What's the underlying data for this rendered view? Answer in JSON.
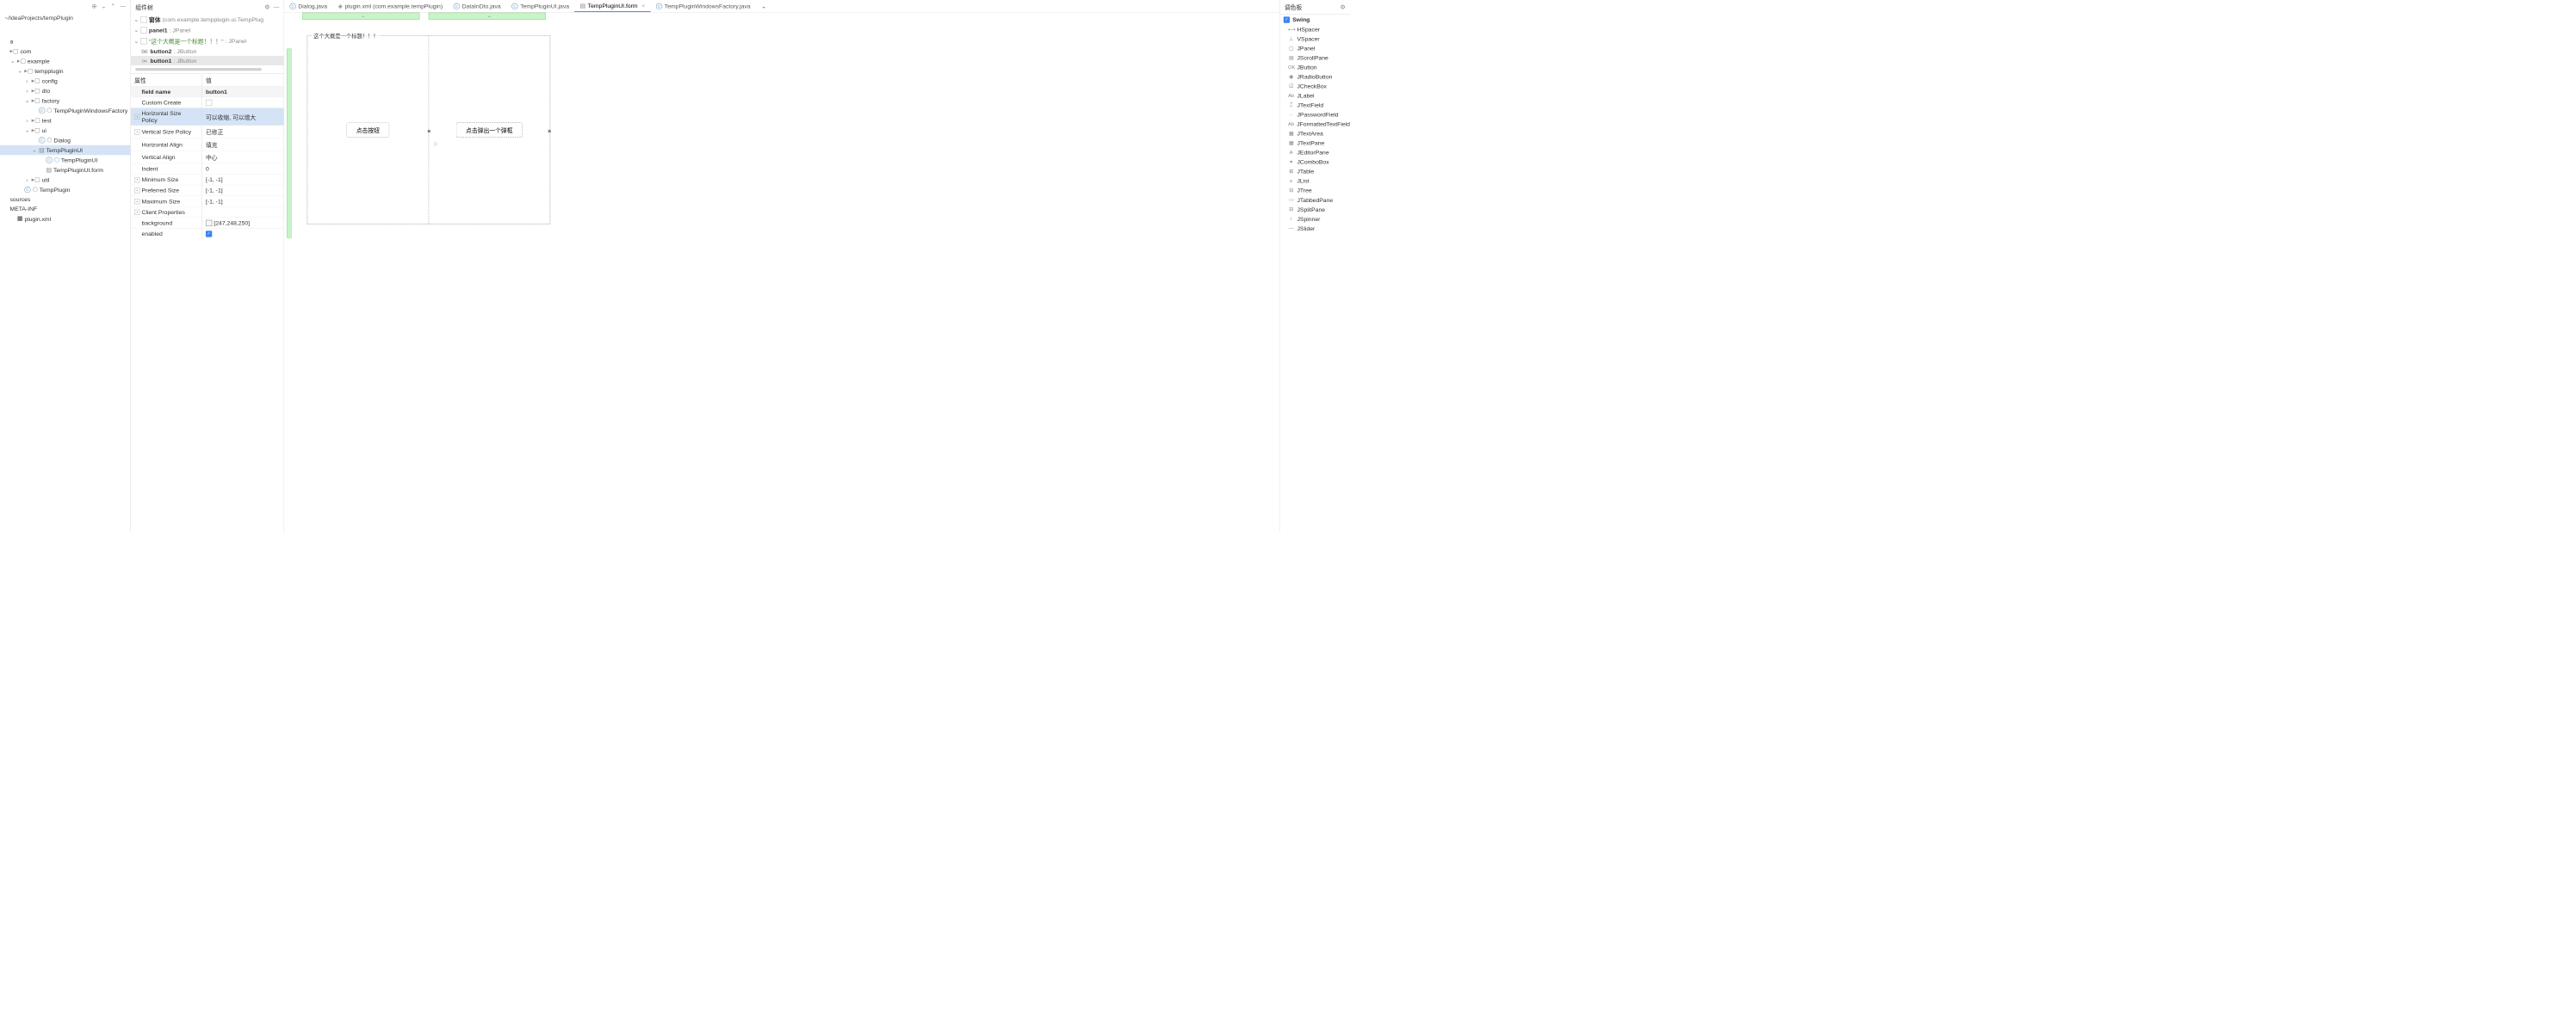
{
  "project": {
    "path": "~/IdeaProjects/tempPlugin",
    "tree": [
      {
        "indent": 0,
        "icon": "text",
        "label": "a"
      },
      {
        "indent": 0,
        "icon": "folder",
        "label": "com"
      },
      {
        "indent": 1,
        "icon": "folder",
        "label": "example",
        "chevron": "v"
      },
      {
        "indent": 2,
        "icon": "folder",
        "label": "tempplugin",
        "chevron": "v"
      },
      {
        "indent": 3,
        "icon": "folder",
        "label": "config",
        "chevron": ">"
      },
      {
        "indent": 3,
        "icon": "folder",
        "label": "dto",
        "chevron": ">"
      },
      {
        "indent": 3,
        "icon": "folder",
        "label": "factory",
        "chevron": "v"
      },
      {
        "indent": 4,
        "icon": "java",
        "label": "TempPluginWindowsFactory"
      },
      {
        "indent": 3,
        "icon": "folder",
        "label": "test",
        "chevron": ">"
      },
      {
        "indent": 3,
        "icon": "folder",
        "label": "ui",
        "chevron": "v"
      },
      {
        "indent": 4,
        "icon": "java",
        "label": "Dialog"
      },
      {
        "indent": 4,
        "icon": "form",
        "label": "TempPluginUI",
        "chevron": "v",
        "selected": true
      },
      {
        "indent": 5,
        "icon": "java",
        "label": "TempPluginUI"
      },
      {
        "indent": 5,
        "icon": "form",
        "label": "TempPluginUI.form"
      },
      {
        "indent": 3,
        "icon": "folder",
        "label": "util",
        "chevron": ">"
      },
      {
        "indent": 2,
        "icon": "java",
        "label": "TempPlugin"
      },
      {
        "indent": 0,
        "icon": "text",
        "label": "sources"
      },
      {
        "indent": 0,
        "icon": "text",
        "label": "META-INF"
      },
      {
        "indent": 1,
        "icon": "xml",
        "label": "plugin.xml"
      }
    ]
  },
  "componentTree": {
    "title": "组件树",
    "items": [
      {
        "indent": 0,
        "chevron": "v",
        "name": "窗体",
        "type": "(com.example.tempplugin.ui.TempPlug"
      },
      {
        "indent": 1,
        "chevron": "v",
        "name": "panel1",
        "type": ": JPanel"
      },
      {
        "indent": 2,
        "chevron": "v",
        "title": "\"这个大概是一个标题！！！\"",
        "type": ": JPanel"
      },
      {
        "indent": 3,
        "ok": true,
        "name": "button2",
        "type": ": JButton"
      },
      {
        "indent": 3,
        "ok": true,
        "name": "button1",
        "type": ": JButton",
        "selected": true
      }
    ]
  },
  "properties": {
    "headers": {
      "name": "属性",
      "value": "值"
    },
    "rows": [
      {
        "name": "field name",
        "value": "button1",
        "header": true
      },
      {
        "name": "Custom Create",
        "value_type": "checkbox_empty"
      },
      {
        "name": "Horizontal Size Policy",
        "value": "可以收缩, 可以增大",
        "expandable": true,
        "selected": true
      },
      {
        "name": "Vertical Size Policy",
        "value": "已修正",
        "expandable": true
      },
      {
        "name": "Horizontal Align",
        "value": "填充"
      },
      {
        "name": "Vertical Align",
        "value": "中心"
      },
      {
        "name": "Indent",
        "value": "0"
      },
      {
        "name": "Minimum Size",
        "value": "[-1, -1]",
        "expandable": true
      },
      {
        "name": "Preferred Size",
        "value": "[-1, -1]",
        "expandable": true
      },
      {
        "name": "Maximum Size",
        "value": "[-1, -1]",
        "expandable": true
      },
      {
        "name": "Client Properties",
        "value": "",
        "expandable": true
      },
      {
        "name": "background",
        "value": "[247,248,250]",
        "color": true
      },
      {
        "name": "enabled",
        "value_type": "checkbox_checked"
      }
    ]
  },
  "tabs": [
    {
      "icon": "java",
      "label": "Dialog.java"
    },
    {
      "icon": "xml",
      "label": "plugin.xml (com.example.tempPlugin)"
    },
    {
      "icon": "java",
      "label": "DataInDto.java"
    },
    {
      "icon": "java",
      "label": "TempPluginUI.java"
    },
    {
      "icon": "form",
      "label": "TempPluginUI.form",
      "active": true,
      "close": true
    },
    {
      "icon": "java",
      "label": "TempPluginWindowsFactory.java"
    }
  ],
  "designer": {
    "formTitle": "这个大概是一个标题！！！",
    "button1": "点击按钮",
    "button2": "点击弹出一个弹框"
  },
  "palette": {
    "title": "调色板",
    "group": "Swing",
    "items": [
      {
        "icon": "⟷",
        "label": "HSpacer"
      },
      {
        "icon": "⊥",
        "label": "VSpacer"
      },
      {
        "icon": "▢",
        "label": "JPanel"
      },
      {
        "icon": "▤",
        "label": "JScrollPane"
      },
      {
        "icon": "OK",
        "label": "JButton"
      },
      {
        "icon": "◉",
        "label": "JRadioButton"
      },
      {
        "icon": "☑",
        "label": "JCheckBox"
      },
      {
        "icon": "Ab",
        "label": "JLabel"
      },
      {
        "icon": "⌶",
        "label": "JTextField"
      },
      {
        "icon": "··",
        "label": "JPasswordField"
      },
      {
        "icon": "Ab",
        "label": "JFormattedTextField"
      },
      {
        "icon": "▦",
        "label": "JTextArea"
      },
      {
        "icon": "▦",
        "label": "JTextPane"
      },
      {
        "icon": "A",
        "label": "JEditorPane"
      },
      {
        "icon": "▾",
        "label": "JComboBox"
      },
      {
        "icon": "⊞",
        "label": "JTable"
      },
      {
        "icon": "≡",
        "label": "JList"
      },
      {
        "icon": "⊟",
        "label": "JTree"
      },
      {
        "icon": "▭",
        "label": "JTabbedPane"
      },
      {
        "icon": "⊟",
        "label": "JSplitPane"
      },
      {
        "icon": "↕",
        "label": "JSpinner"
      },
      {
        "icon": "—",
        "label": "JSlider"
      }
    ]
  }
}
